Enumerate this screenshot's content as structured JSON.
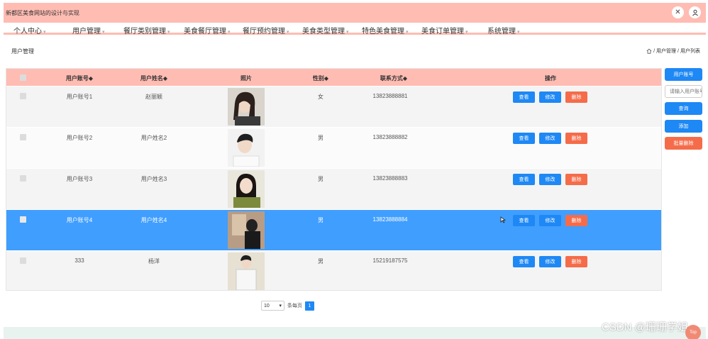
{
  "app": {
    "title": "新都区美食网站的设计与实现"
  },
  "nav": {
    "items": [
      {
        "label": "个人中心"
      },
      {
        "label": "用户管理"
      },
      {
        "label": "餐厅类别管理"
      },
      {
        "label": "美食餐厅管理"
      },
      {
        "label": "餐厅预约管理"
      },
      {
        "label": "美食类型管理"
      },
      {
        "label": "特色美食管理"
      },
      {
        "label": "美食订单管理"
      },
      {
        "label": "系统管理"
      }
    ]
  },
  "page": {
    "title": "用户管理",
    "breadcrumb": [
      "用户管理",
      "用户列表"
    ],
    "breadcrumb_sep": "/"
  },
  "table": {
    "headers": [
      "用户账号",
      "用户姓名",
      "照片",
      "性别",
      "联系方式",
      "操作"
    ],
    "rows": [
      {
        "account": "用户账号1",
        "name": "赵丽颖",
        "gender": "女",
        "phone": "13823888881"
      },
      {
        "account": "用户账号2",
        "name": "用户姓名2",
        "gender": "男",
        "phone": "13823888882"
      },
      {
        "account": "用户账号3",
        "name": "用户姓名3",
        "gender": "男",
        "phone": "13823888883"
      },
      {
        "account": "用户账号4",
        "name": "用户姓名4",
        "gender": "男",
        "phone": "13823888884"
      },
      {
        "account": "333",
        "name": "杨洋",
        "gender": "男",
        "phone": "15219187575"
      }
    ],
    "actions": {
      "view": "查看",
      "edit": "修改",
      "delete": "删除"
    },
    "selected_row": 4
  },
  "side": {
    "search_field_label": "用户账号",
    "search_placeholder": "请输入用户账号",
    "query": "查询",
    "add": "添加",
    "batch_delete": "批量删除"
  },
  "pager": {
    "page_size": "10",
    "per_page_label": "条每页",
    "current_page": "1"
  },
  "footer": {
    "watermark": "CSDN @珊珊学姐",
    "top": "Top"
  },
  "colors": {
    "header_bg": "#ffbcb3",
    "accent": "#1e88f5",
    "danger": "#f56c4a",
    "selected_row": "#409eff"
  }
}
